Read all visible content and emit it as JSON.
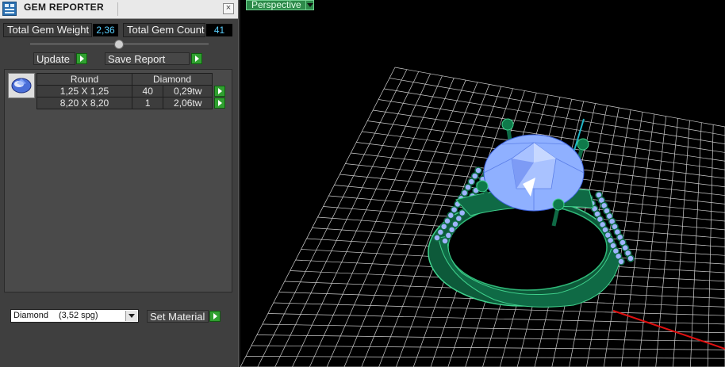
{
  "panel": {
    "title": "GEM REPORTER",
    "close_glyph": "×",
    "total_weight_label": "Total Gem Weight",
    "total_weight_value": "2,36",
    "total_count_label": "Total Gem Count",
    "total_count_value": "41",
    "update_label": "Update",
    "save_report_label": "Save Report",
    "table": {
      "col_shape": "Round",
      "col_material": "Diamond",
      "rows": [
        {
          "size": "1,25 X 1,25",
          "count": "40",
          "weight": "0,29tw"
        },
        {
          "size": "8,20 X 8,20",
          "count": "1",
          "weight": "2,06tw"
        }
      ]
    },
    "material_select": {
      "name": "Diamond",
      "spg": "(3,52 spg)"
    },
    "set_material_label": "Set Material"
  },
  "viewport": {
    "view_name": "Perspective"
  },
  "colors": {
    "accent_green": "#30a030",
    "value_cyan": "#5ad0ff",
    "ring_green": "#0f6a45",
    "gem_blue": "#8fb0ff",
    "grid": "#cfcfcf",
    "axis_red": "#e01010",
    "axis_cyan": "#20b8c8"
  }
}
